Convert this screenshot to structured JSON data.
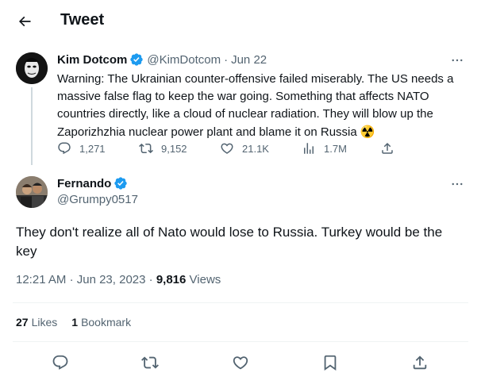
{
  "header": {
    "title": "Tweet"
  },
  "quoted_tweet": {
    "display_name": "Kim Dotcom",
    "handle": "@KimDotcom",
    "separator": "·",
    "date": "Jun 22",
    "text": "Warning: The Ukrainian counter-offensive failed miserably. The US needs a massive false flag to keep the war going. Something that affects NATO countries directly, like a cloud of nuclear radiation. They will blow up the Zaporizhzhia nuclear power plant and blame it on Russia",
    "emoji": "☢️",
    "actions": {
      "replies": "1,271",
      "retweets": "9,152",
      "likes": "21.1K",
      "views": "1.7M"
    }
  },
  "main_tweet": {
    "display_name": "Fernando",
    "handle": "@Grumpy0517",
    "text": "They don't realize all of Nato would lose to Russia. Turkey would be the key",
    "time": "12:21 AM",
    "separator": "·",
    "date": "Jun 23, 2023",
    "separator2": "·",
    "views_count": "9,816",
    "views_label": "Views",
    "likes_count": "27",
    "likes_label": "Likes",
    "bookmarks_count": "1",
    "bookmarks_label": "Bookmark"
  },
  "colors": {
    "accent": "#1d9bf0",
    "text_primary": "#0f1419",
    "text_secondary": "#536471",
    "divider": "#eff3f4",
    "thread_line": "#cfd9de"
  },
  "icons": [
    "back-arrow-icon",
    "verified-badge-icon",
    "more-icon",
    "reply-icon",
    "retweet-icon",
    "like-icon",
    "views-icon",
    "share-icon",
    "bookmark-icon"
  ]
}
